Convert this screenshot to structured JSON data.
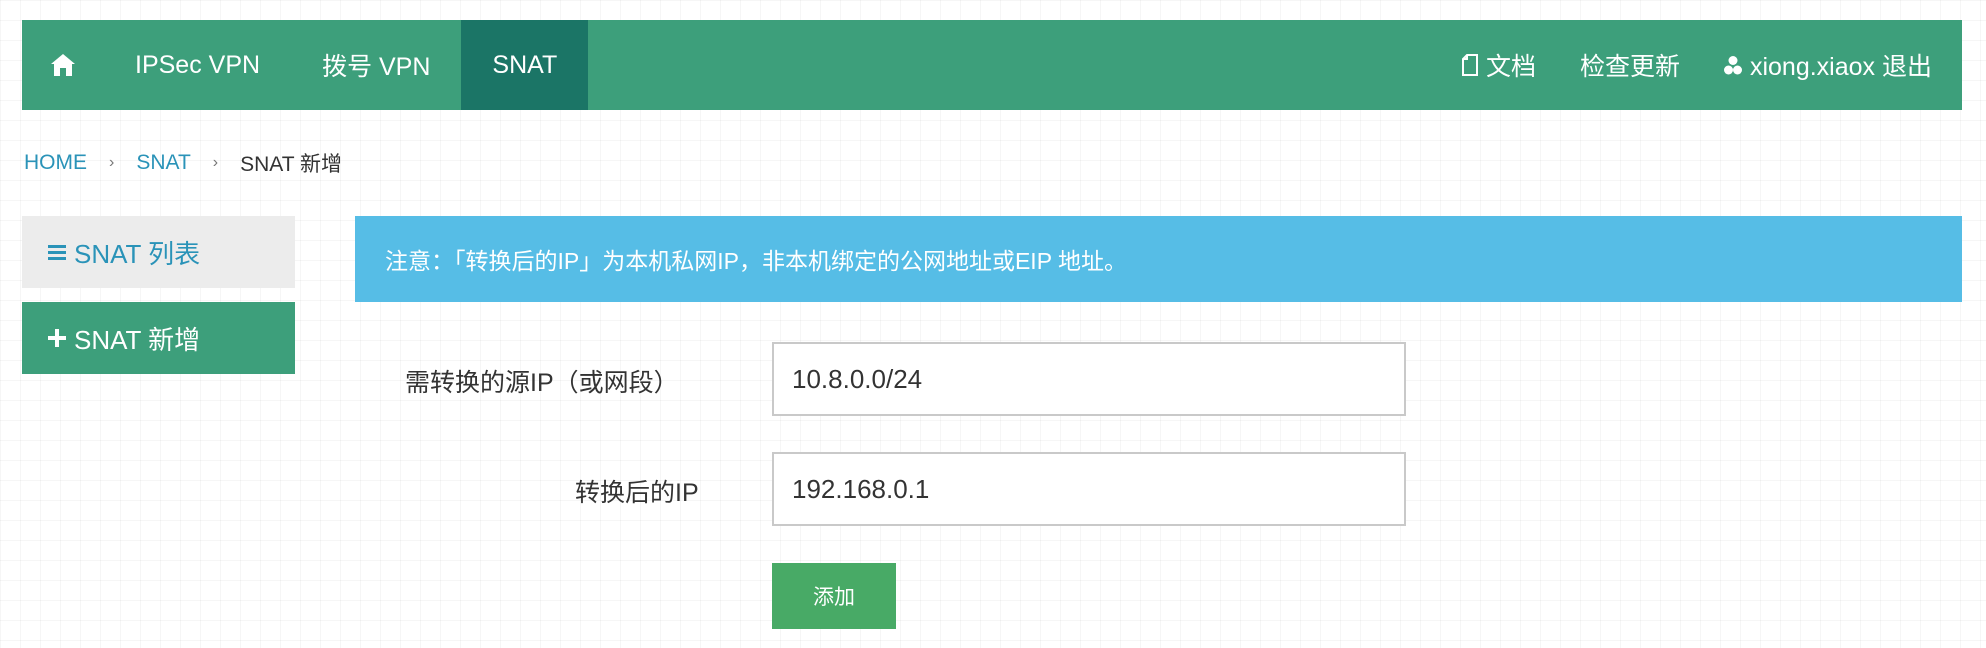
{
  "nav": {
    "home_icon": "home-icon",
    "items": [
      {
        "label": "IPSec VPN"
      },
      {
        "label": "拨号 VPN"
      },
      {
        "label": "SNAT",
        "active": true
      }
    ],
    "right": {
      "docs_icon": "document-icon",
      "docs_label": "文档",
      "update_label": "检查更新",
      "user_icon": "user-icon",
      "user_label": "xiong.xiaox 退出"
    }
  },
  "breadcrumb": {
    "items": [
      "HOME",
      "SNAT"
    ],
    "separator": "›",
    "current": "SNAT 新增"
  },
  "sidebar": {
    "list_icon": "list-icon",
    "list_label": "SNAT 列表",
    "add_icon": "plus-icon",
    "add_label": "SNAT 新增"
  },
  "alert": {
    "text": "注意：「转换后的IP」为本机私网IP，非本机绑定的公网地址或EIP 地址。"
  },
  "form": {
    "source_label": "需转换的源IP（或网段）",
    "source_value": "10.8.0.0/24",
    "target_label": "转换后的IP",
    "target_value": "192.168.0.1",
    "submit_label": "添加"
  },
  "colors": {
    "navbar": "#3d9f7b",
    "navbar_active": "#1b7566",
    "link": "#2a93b8",
    "alert": "#56bde6",
    "button": "#48aa66"
  }
}
